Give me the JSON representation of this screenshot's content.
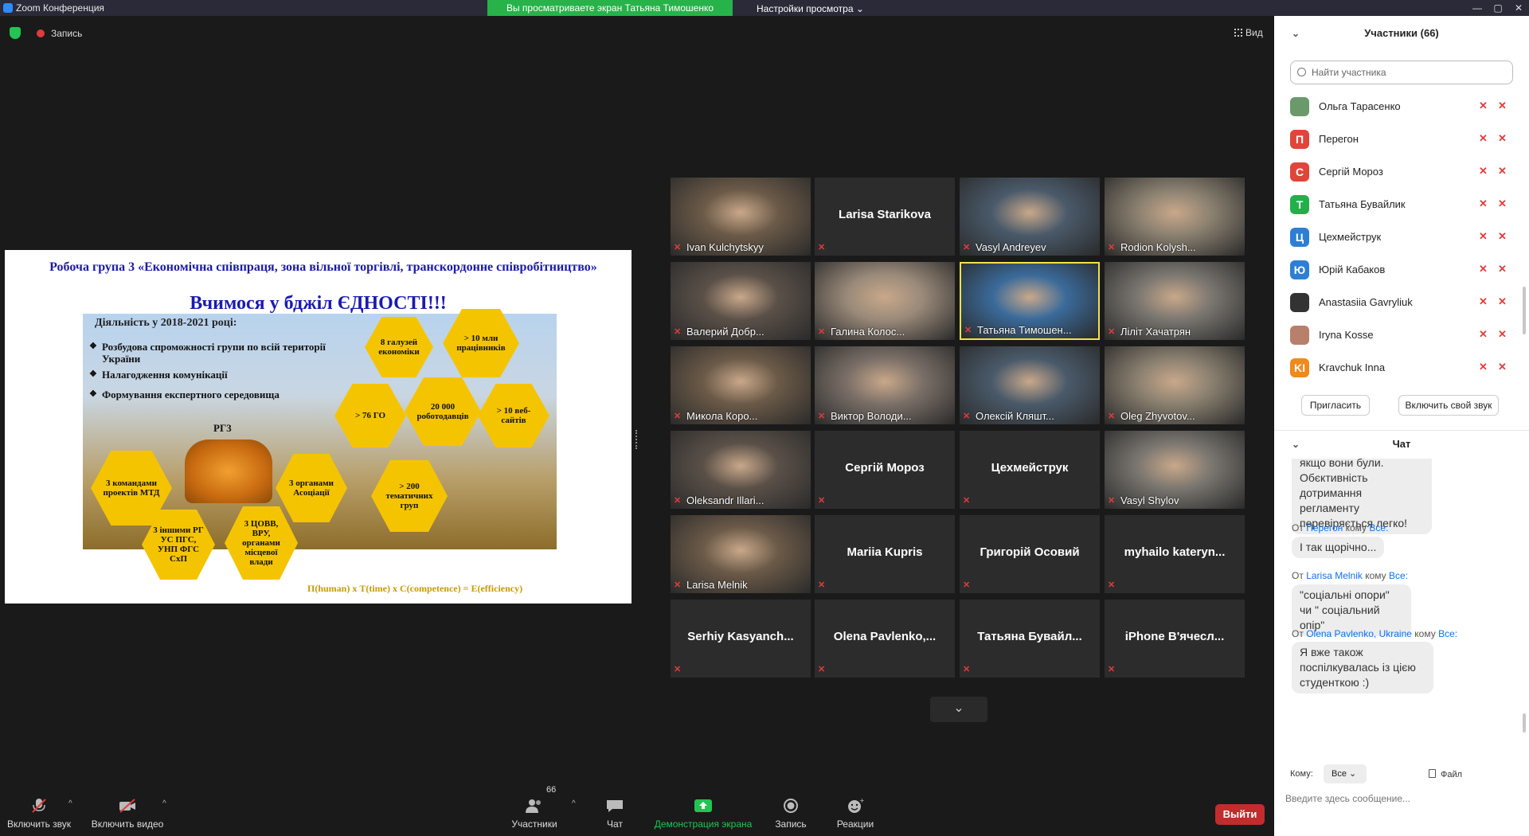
{
  "window": {
    "title": "Zoom Конференция",
    "controls": [
      "—",
      "▢",
      "✕"
    ]
  },
  "banner": {
    "sharing_text": "Вы просматриваете экран Татьяна Тимошенко",
    "view_settings": "Настройки просмотра"
  },
  "meeting_top": {
    "record_label": "Запись",
    "view_label": "Вид"
  },
  "slide": {
    "title": "Робоча група 3 «Економічна співпраця, зона вільної торгівлі, транскордонне співробітництво»",
    "motto": "Вчимося у бджіл ЄДНОСТІ!!!",
    "subhead": "Діяльність у 2018-2021 році:",
    "bullets": [
      "Розбудова спроможності групи по всій території України",
      "Налагодження комунікації",
      "Формування експертного середовища"
    ],
    "rg3_label": "РГ3",
    "hexes": [
      "8 галузей економіки",
      "> 10 млн працівників",
      "> 76 ГО",
      "20 000 роботодавців",
      "> 10 веб-сайтів",
      "> 200 тематичних груп",
      "3 командами проектів МТД",
      "3 органами Асоціації",
      "3 іншими РГ УС ПГС, УНП ФГС СхП",
      "3 ЦОВВ, ВРУ, органами місцевої влади"
    ],
    "formula": "П(human) x Т(time) x С(competence) = E(efficiency)"
  },
  "gallery": {
    "tiles": [
      {
        "name": "Ivan Kulchytskyy",
        "video": true
      },
      {
        "name": "Larisa Starikova",
        "video": false
      },
      {
        "name": "Vasyl Andreyev",
        "video": true
      },
      {
        "name": "Rodion Kolysh...",
        "video": true
      },
      {
        "name": "Валерий Добр...",
        "video": true
      },
      {
        "name": "Галина Колос...",
        "video": true
      },
      {
        "name": "Татьяна Тимошен...",
        "video": true,
        "active": true
      },
      {
        "name": "Лілiт Хачатрян",
        "video": true
      },
      {
        "name": "Микола Коро...",
        "video": true
      },
      {
        "name": "Виктор Володи...",
        "video": true
      },
      {
        "name": "Олексій Кляшт...",
        "video": true
      },
      {
        "name": "Oleg Zhyvotov...",
        "video": true
      },
      {
        "name": "Oleksandr Illari...",
        "video": true
      },
      {
        "name": "Сергій Мороз",
        "video": false
      },
      {
        "name": "Цехмейструк",
        "video": false
      },
      {
        "name": "Vasyl Shylov",
        "video": true
      },
      {
        "name": "Larisa Melnik",
        "video": true
      },
      {
        "name": "Mariia Kupris",
        "video": false
      },
      {
        "name": "Григорій Осовий",
        "video": false
      },
      {
        "name": "myhailo  kateryn...",
        "video": false
      },
      {
        "name": "Serhiy  Kasyanch...",
        "video": false
      },
      {
        "name": "Olena  Pavlenko,...",
        "video": false
      },
      {
        "name": "Татьяна  Бувайл...",
        "video": false
      },
      {
        "name": "iPhone  В'ячесл...",
        "video": false
      }
    ]
  },
  "toolbar": {
    "audio": "Включить звук",
    "video": "Включить видео",
    "participants": "Участники",
    "participants_count": "66",
    "chat": "Чат",
    "share": "Демонстрация экрана",
    "record": "Запись",
    "reactions": "Реакции",
    "leave": "Выйти"
  },
  "participants_panel": {
    "title": "Участники (66)",
    "search_placeholder": "Найти участника",
    "invite": "Пригласить",
    "unmute_me": "Включить свой звук",
    "list": [
      {
        "name": "Ольга Тарасенко",
        "initial": "",
        "color": "#6a9a6a"
      },
      {
        "name": "Перегон",
        "initial": "П",
        "color": "#e0453a"
      },
      {
        "name": "Сергій Мороз",
        "initial": "С",
        "color": "#e0453a"
      },
      {
        "name": "Татьяна Бувайлик",
        "initial": "Т",
        "color": "#23b04a"
      },
      {
        "name": "Цехмейструк",
        "initial": "Ц",
        "color": "#2d7fd3"
      },
      {
        "name": "Юрій Кабаков",
        "initial": "Ю",
        "color": "#2d7fd3"
      },
      {
        "name": "Anastasiia Gavryliuk",
        "initial": "",
        "color": "#333333"
      },
      {
        "name": "Iryna Kosse",
        "initial": "",
        "color": "#b8806a"
      },
      {
        "name": "Kravchuk Inna",
        "initial": "KI",
        "color": "#f08a1c"
      }
    ]
  },
  "chat": {
    "title": "Чат",
    "messages": [
      {
        "text": "якщо вони були. Обєктивність дотримання регламенту перевіряється легко!"
      },
      {
        "from_prefix": "От",
        "from": "Перегон",
        "to_prefix": "кому",
        "to": "Все:",
        "text": "І так щорічно..."
      },
      {
        "from_prefix": "От",
        "from": "Larisa Melnik",
        "to_prefix": "кому",
        "to": "Все:",
        "text": "\"соціальні опори\"  чи \" соціальний опір\""
      },
      {
        "from_prefix": "От",
        "from": "Olena Pavlenko, Ukraine",
        "to_prefix": "кому",
        "to": "Все:",
        "text": "Я вже також поспілкувалась із цією студенткою :)"
      }
    ],
    "to_label": "Кому:",
    "to_value": "Все",
    "file_label": "Файл",
    "input_placeholder": "Введите здесь сообщение..."
  }
}
